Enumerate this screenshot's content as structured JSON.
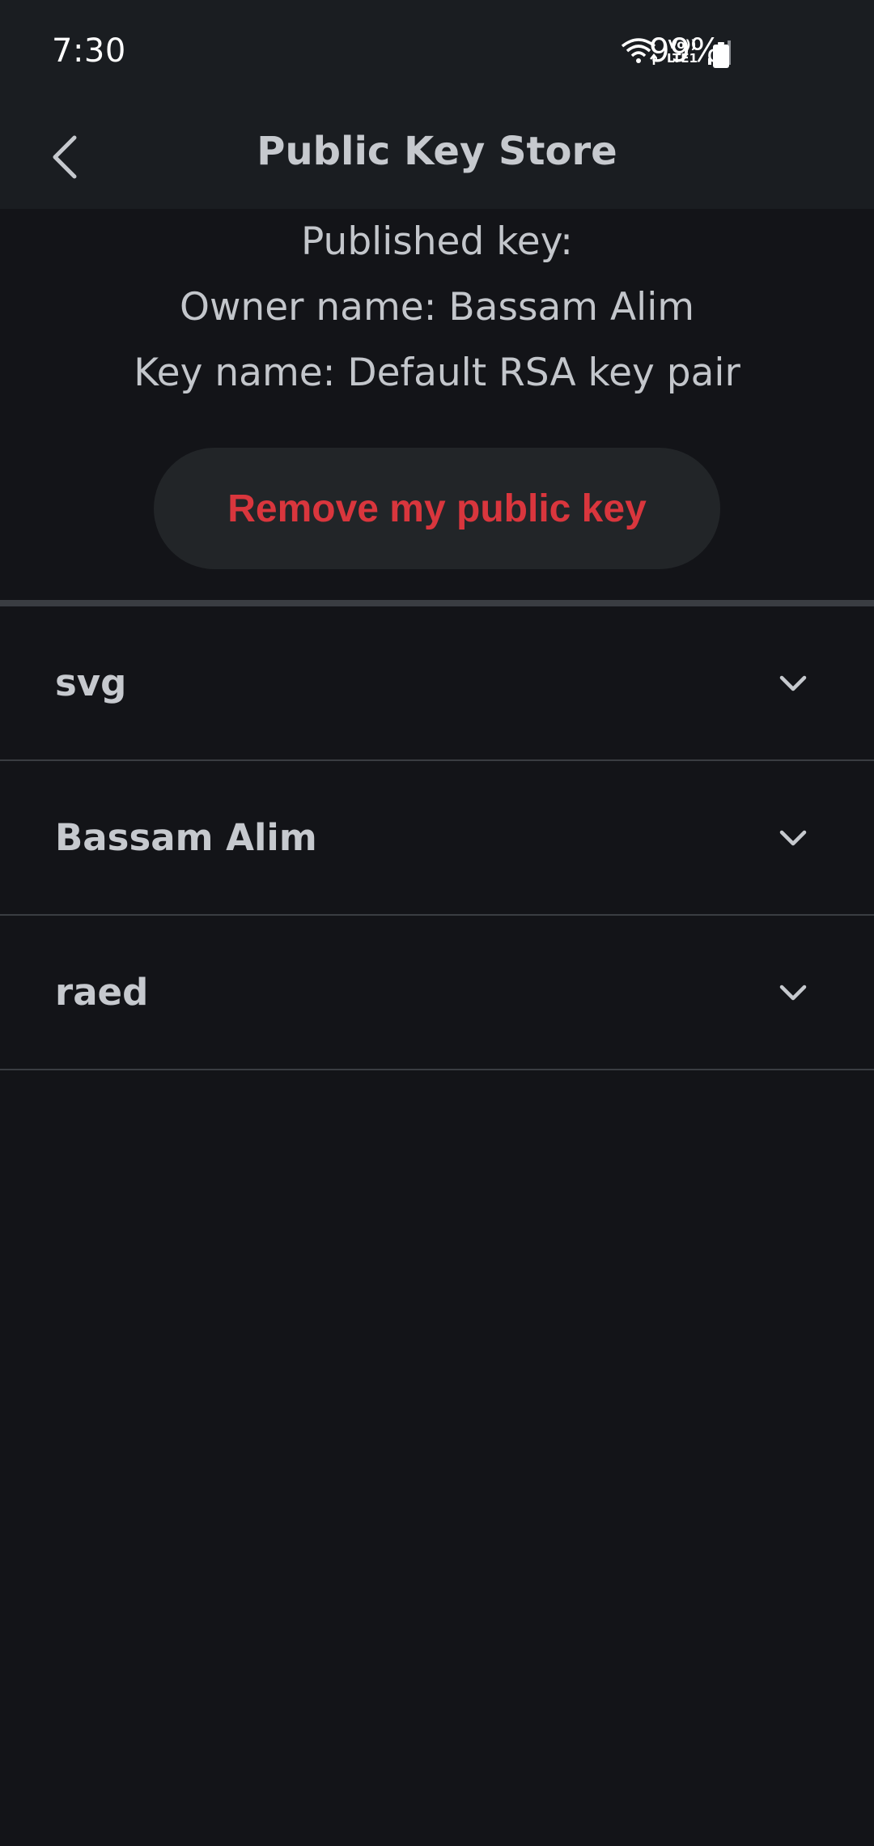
{
  "status_bar": {
    "time": "7:30",
    "network_label_top": "Vo))",
    "network_label_bottom": "LTE1",
    "battery_percent": "99%"
  },
  "app_bar": {
    "title": "Public Key Store",
    "back_icon": "chevron-left-icon"
  },
  "published_key": {
    "heading": "Published key:",
    "owner_line": "Owner name: Bassam Alim",
    "key_line": "Key name: Default RSA key pair",
    "remove_button": "Remove my public key"
  },
  "key_list": {
    "items": [
      {
        "name": "svg",
        "icon": "chevron-down-icon"
      },
      {
        "name": "Bassam Alim",
        "icon": "chevron-down-icon"
      },
      {
        "name": "raed",
        "icon": "chevron-down-icon"
      }
    ]
  },
  "colors": {
    "background": "#131418",
    "app_bar": "#1a1d21",
    "danger": "#d9363d",
    "button_bg": "#222528",
    "text": "#c6c9ce"
  }
}
